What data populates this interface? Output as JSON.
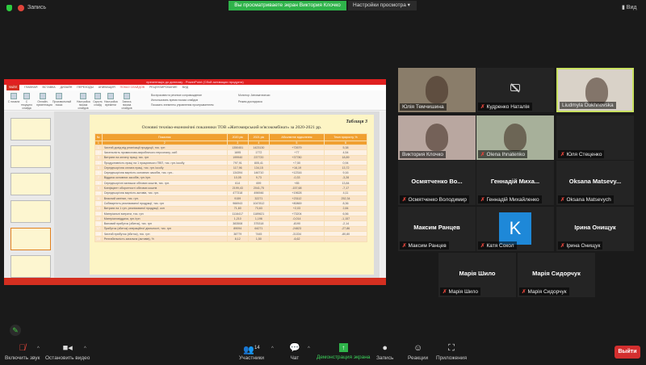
{
  "topbar": {
    "record_label": "Запись",
    "share_banner": "Вы просматриваете экран Виктория Клочко",
    "view_settings": "Настройки просмотра ▾",
    "view_button": "▮ Вид"
  },
  "ppt": {
    "window_title": "презентація до диплому - PowerPoint (Сбой активации продукта)",
    "tabs": [
      "ФАЙЛ",
      "ГЛАВНАЯ",
      "ВСТАВКА",
      "ДИЗАЙН",
      "ПЕРЕХОДЫ",
      "АНИМАЦИЯ",
      "ПОКАЗ СЛАЙДОВ",
      "РЕЦЕНЗИРОВАНИЕ",
      "ВИД"
    ],
    "ribbon": [
      "С начала",
      "С текущего слайда",
      "Онлайн-презентация",
      "Произвольный показ",
      "Настройка показа слайдов",
      "Скрыть слайд",
      "Настройка времени",
      "Запись показа слайдов"
    ],
    "checks": [
      "Воспроизвести речевое сопровождение",
      "Использовать время показа слайдов",
      "Показать элементы управления проигрывателем"
    ],
    "monitor": "Монитор: Автоматически",
    "presenter": "Режим докладчика",
    "slide": {
      "caption": "Таблиця 3",
      "title": "Основні техніко-економічні показники ТОВ «Житомирський м'ясокомбінат» за 2020-2021 рр.",
      "headers": [
        "№",
        "Показник",
        "2020 рік",
        "2021 рік",
        "Абсолютне відхилення",
        "Темп приросту, %"
      ],
      "subheader": [
        "1",
        "2",
        "3",
        "4",
        "5",
        "6"
      ],
      "rows": [
        [
          "1",
          "Чистий дохід від реалізації продукції, тис. грн",
          "1350451",
          "1423130",
          "+72679",
          "5,38"
        ],
        [
          "2",
          "Чисельність промислово-виробничого персоналу, осіб",
          "1695",
          "1772",
          "+77",
          "4,54"
        ],
        [
          "3",
          "Витрати на оплату праці, тис. грн",
          "199940",
          "237720",
          "+37780",
          "18,89"
        ],
        [
          "4",
          "Продуктивність праці на 1 працюючого ПВП, тис. грн./особу",
          "797,91",
          "805,41",
          "+7,50",
          "0,94"
        ],
        [
          "5",
          "Середньорічна оплата праці, тис. грн./особу",
          "117,96",
          "134,15",
          "+16,19",
          "13,72"
        ],
        [
          "6",
          "Середньорічна вартість основних засобів, тис. грн..",
          "134394",
          "146710",
          "+12316",
          "9,16"
        ],
        [
          "7",
          "Віддача основних засобів, грн./грн.",
          "10,05",
          "9,73",
          "-0,33",
          "-3,28"
        ],
        [
          "8",
          "Середньорічні залишки обігових коштів, тис. грн.",
          "614",
          "699",
          "+85",
          "13,84"
        ],
        [
          "9",
          "Коефіцієнт оборотності обігових коштів",
          "2199,43",
          "2041,75",
          "-157,68",
          "-7,17"
        ],
        [
          "10",
          "Середньорічна вартість активів, тис. грн.",
          "477318",
          "496946",
          "+19628",
          "4,11"
        ],
        [
          "11",
          "Власний капітал, тис. грн.",
          "9159",
          "32271",
          "+23112",
          "252,34"
        ],
        [
          "12",
          "Собівартість реалізованої продукції, тис. грн",
          "966943",
          "1047812",
          "+80869",
          "8,36"
        ],
        [
          "13",
          "Витрати на 1 грн. реалізованої продукції, коп",
          "71,60",
          "73,63",
          "+2,03",
          "2,84"
        ],
        [
          "14",
          "Матеріальні витрати, тис. грн",
          "1116417",
          "1189621",
          "+73204",
          "6,56"
        ],
        [
          "15",
          "Матеріаловіддача, грн./грн",
          "1,210",
          "1,196",
          "-0,014",
          "-1,157"
        ],
        [
          "16",
          "Валовий прибуток (збиток), тис. грн",
          "383508",
          "375318",
          "-8190",
          "-2,14"
        ],
        [
          "17",
          "Прибуток (збиток) операційної діяльності, тис. грн",
          "89094",
          "64271",
          "-24823",
          "-27,86"
        ],
        [
          "18",
          "Чистий прибуток (збиток), тис. грн",
          "38779",
          "7445",
          "-31334",
          "-80,80"
        ],
        [
          "19",
          "Рентабельність загальна (активів), %",
          "8,12",
          "1,50",
          "-6,62",
          "-"
        ]
      ]
    }
  },
  "participants": [
    {
      "name": "Юлія Темчишина",
      "video": true,
      "muted": false
    },
    {
      "name": "Кудренко Наталія",
      "camoff": true,
      "muted": true
    },
    {
      "name": "Liudmyla Dukhnovska",
      "video": true,
      "muted": false,
      "speaking": true
    },
    {
      "name": "Виктория Клочко",
      "video": true,
      "muted": false
    },
    {
      "name": "Olena Ihnatenko",
      "video": true,
      "muted": true
    },
    {
      "name": "Юля Стеценко",
      "muted": true
    },
    {
      "name": "Осмятченко Володимир",
      "display": "Осмятченко Во...",
      "muted": true
    },
    {
      "name": "Геннадій Михайленко",
      "display": "Геннадій Миха...",
      "muted": true
    },
    {
      "name": "Oksana Matsevych",
      "display": "Oksana Matsevy...",
      "muted": true
    },
    {
      "name": "Максим Ранцев",
      "display": "Максим Ранцев",
      "muted": true
    },
    {
      "name": "Катя Сокол",
      "avatar": "K",
      "muted": true
    },
    {
      "name": "Ірина Онищук",
      "display": "Ірина Онищук",
      "muted": true
    },
    {
      "name": "Марія Шило",
      "display": "Марія Шило",
      "muted": true
    },
    {
      "name": "Марія Сидорчук",
      "display": "Марія Сидорчук",
      "muted": true
    }
  ],
  "toolbar": {
    "unmute": "Включить звук",
    "stop_video": "Остановить видео",
    "participants": "Участники",
    "participants_count": "14",
    "chat": "Чат",
    "share_screen": "Демонстрация экрана",
    "record": "Запись",
    "reactions": "Реакции",
    "apps": "Приложения",
    "leave": "Выйти"
  },
  "colors": {
    "share_green": "#2fb34a",
    "leave_red": "#d32f2f",
    "ppt_red": "#d42f20",
    "table_orange": "#f0a030",
    "speaker_highlight": "#c8e060"
  }
}
